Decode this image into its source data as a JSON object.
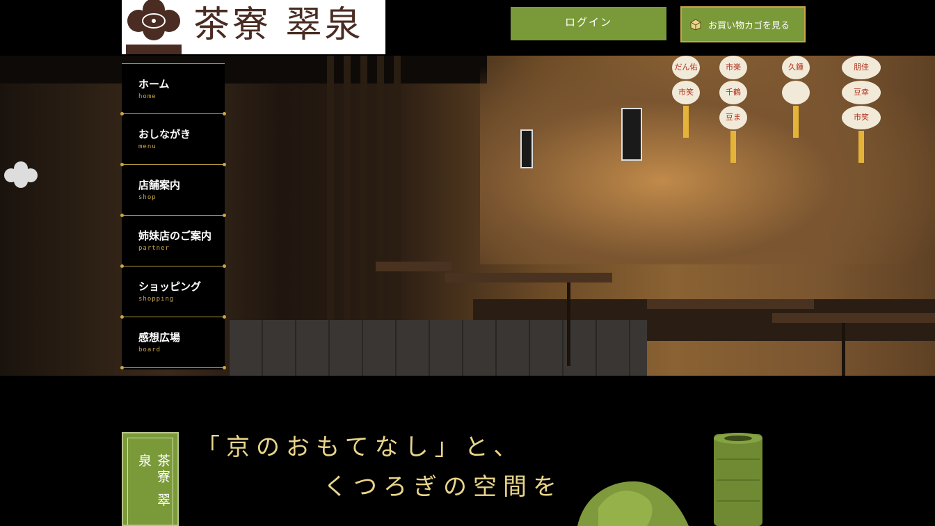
{
  "header": {
    "brand": "茶寮 翠泉",
    "login_label": "ログイン",
    "cart_label": "お買い物カゴを見る"
  },
  "nav": [
    {
      "jp": "ホーム",
      "en": "home"
    },
    {
      "jp": "おしながき",
      "en": "menu"
    },
    {
      "jp": "店舗案内",
      "en": "shop"
    },
    {
      "jp": "姉妹店のご案内",
      "en": "partner"
    },
    {
      "jp": "ショッピング",
      "en": "shopping"
    },
    {
      "jp": "感想広場",
      "en": "board"
    }
  ],
  "hero": {
    "uchiwa": [
      "だん佑",
      "市笑",
      "久鍾",
      "市楽",
      "千鶴",
      "豆ま",
      "朋佳",
      "豆幸",
      "市笑"
    ]
  },
  "intro": {
    "tag": "茶寮 翠泉",
    "catch_line1": "「京のおもてなし」と、",
    "catch_line2": "くつろぎの空間を"
  },
  "colors": {
    "accent_green": "#7a9a3a",
    "gold": "#c8a64a",
    "brand_brown": "#4a2c23",
    "catch_text": "#e9d58a"
  }
}
